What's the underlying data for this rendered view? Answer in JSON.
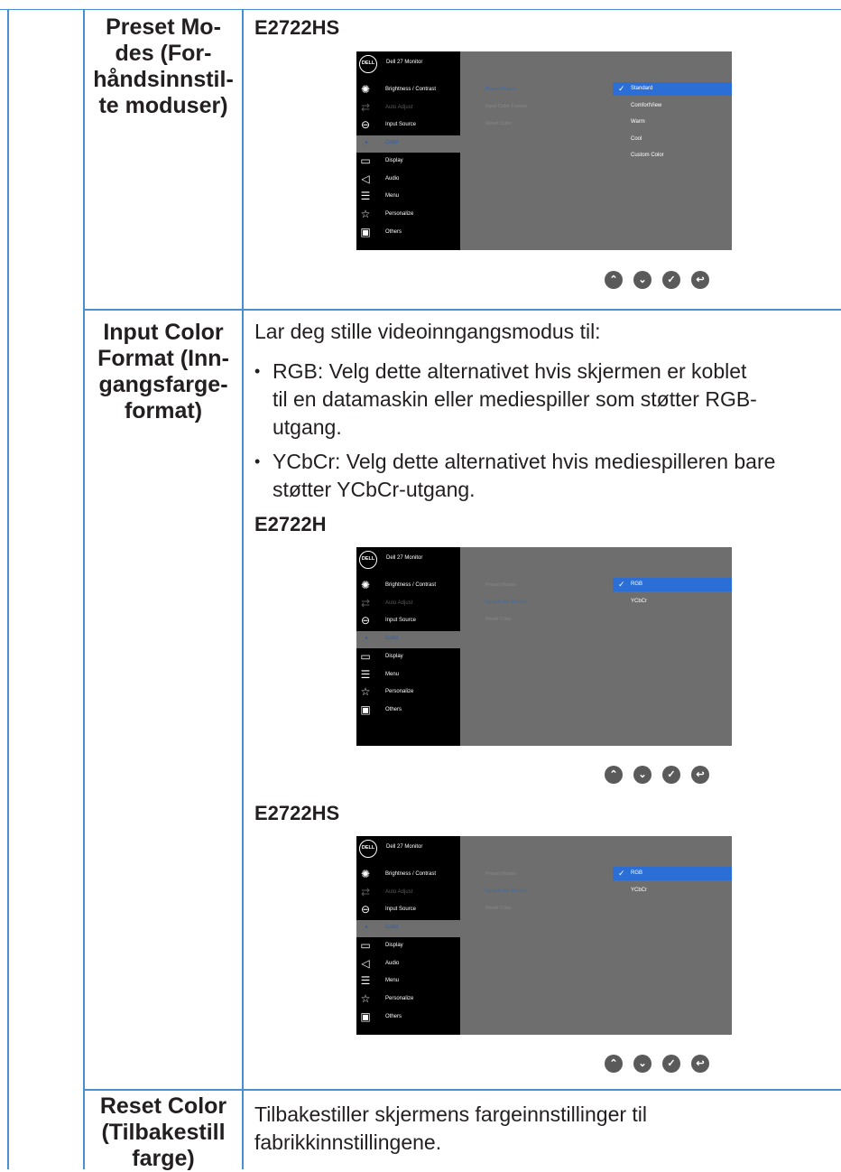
{
  "rows": {
    "preset": {
      "label": [
        "Preset Mo-",
        "des (For-",
        "håndsinnstil-",
        "te moduser)"
      ]
    },
    "input": {
      "label": [
        "Input Color",
        "Format (Inn-",
        "gangsfarge-",
        "format)"
      ]
    },
    "reset": {
      "label": [
        "Reset Color",
        "(Tilbakestill",
        "farge)"
      ]
    }
  },
  "preset_section": {
    "model": "E2722HS"
  },
  "input_section": {
    "intro": "Lar deg stille videoinngangsmodus til:",
    "bullet1_key": "RGB:",
    "bullet1_lines": [
      "Velg dette alternativet hvis skjermen er koblet",
      "til en datamaskin eller mediespiller som støtter RGB-",
      "utgang."
    ],
    "bullet2_key": "YCbCr:",
    "bullet2_lines": [
      "Velg dette alternativet hvis mediespilleren bare",
      "støtter YCbCr-utgang."
    ],
    "model_a": "E2722H",
    "model_b": "E2722HS"
  },
  "reset_section": {
    "lines": [
      "Tilbakestiller skjermens fargeinnstillinger til",
      "fabrikkinnstillingene."
    ]
  },
  "osd": {
    "logo": "DELL",
    "title": "Dell 27 Monitor",
    "menu_hs": [
      "Brightness / Contrast",
      "Auto Adjust",
      "Input Source",
      "Color",
      "Display",
      "Audio",
      "Menu",
      "Personalize",
      "Others"
    ],
    "menu_h": [
      "Brightness / Contrast",
      "Auto Adjust",
      "Input Source",
      "Color",
      "Display",
      "Menu",
      "Personalize",
      "Others"
    ],
    "submenu": [
      "Preset Modes",
      "Input Color Format",
      "Reset Color"
    ],
    "preset_options": [
      "Standard",
      "ComfortView",
      "Warm",
      "Cool",
      "Custom Color"
    ],
    "format_options": [
      "RGB",
      "YCbCr"
    ]
  },
  "icons": {
    "up": "chevron-up-icon",
    "down": "chevron-down-icon",
    "ok": "checkmark-icon",
    "back": "back-icon"
  }
}
